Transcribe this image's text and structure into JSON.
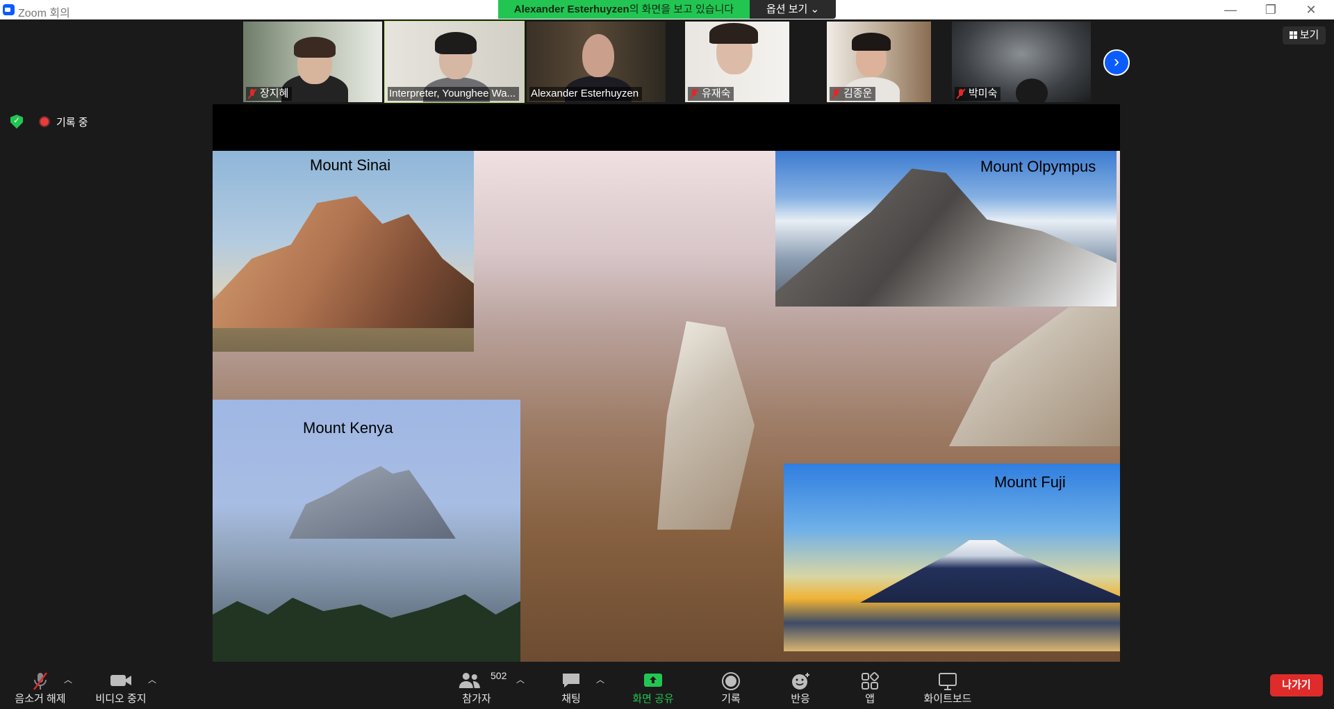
{
  "window": {
    "title": "Zoom 회의"
  },
  "share_banner": {
    "presenter": "Alexander  Esterhuyzen",
    "suffix": "의 화면을 보고 있습니다",
    "options_label": "옵션 보기 ⌄"
  },
  "window_controls": {
    "minimize": "—",
    "restore": "❐",
    "close": "✕"
  },
  "participants": [
    {
      "name": "장지혜",
      "muted": true
    },
    {
      "name": "Interpreter, Younghee Wa...",
      "muted": false
    },
    {
      "name": "Alexander Esterhuyzen",
      "muted": false
    },
    {
      "name": "유재숙",
      "muted": true
    },
    {
      "name": "김종운",
      "muted": true
    },
    {
      "name": "박미숙",
      "muted": true
    }
  ],
  "view_button": {
    "label": "보기"
  },
  "recording": {
    "label": "기록 중"
  },
  "slide": {
    "captions": [
      "Mount Sinai",
      "Mount Olpympus",
      "Mount Kenya",
      "Mount Fuji"
    ]
  },
  "toolbar": {
    "mute": "음소거 해제",
    "video": "비디오 중지",
    "participants": "참가자",
    "participant_count": "502",
    "chat": "채팅",
    "share": "화면 공유",
    "record": "기록",
    "reactions": "반응",
    "apps": "앱",
    "whiteboard": "화이트보드",
    "leave": "나가기"
  },
  "colors": {
    "zoom_blue": "#0b5cff",
    "share_green": "#23c552",
    "leave_red": "#e02b2b"
  }
}
